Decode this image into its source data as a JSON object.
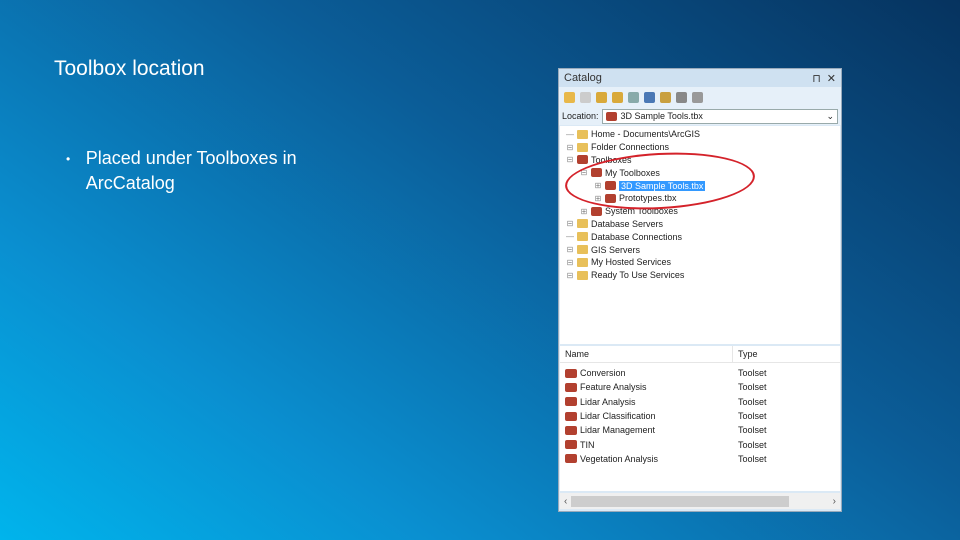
{
  "slide": {
    "title": "Toolbox location",
    "bullet": "Placed under Toolboxes in ArcCatalog",
    "bullet_marker": "•"
  },
  "catalog": {
    "title": "Catalog",
    "pin": "⊓",
    "close": "✕",
    "location_label": "Location:",
    "location_value": "3D Sample Tools.tbx",
    "tree": [
      {
        "label": "Home - Documents\\ArcGIS",
        "indent": 0,
        "icon": "folder",
        "exp": "—"
      },
      {
        "label": "Folder Connections",
        "indent": 0,
        "icon": "folder",
        "exp": "⊟"
      },
      {
        "label": "Toolboxes",
        "indent": 0,
        "icon": "toolbox",
        "exp": "⊟"
      },
      {
        "label": "My Toolboxes",
        "indent": 1,
        "icon": "toolbox",
        "exp": "⊟"
      },
      {
        "label": "3D Sample Tools.tbx",
        "indent": 2,
        "icon": "toolbox",
        "exp": "⊞",
        "selected": true
      },
      {
        "label": "Prototypes.tbx",
        "indent": 2,
        "icon": "toolbox",
        "exp": "⊞"
      },
      {
        "label": "System Toolboxes",
        "indent": 1,
        "icon": "toolbox",
        "exp": "⊞"
      },
      {
        "label": "Database Servers",
        "indent": 0,
        "icon": "folder",
        "exp": "⊟"
      },
      {
        "label": "Database Connections",
        "indent": 0,
        "icon": "folder",
        "exp": "—"
      },
      {
        "label": "GIS Servers",
        "indent": 0,
        "icon": "folder",
        "exp": "⊟"
      },
      {
        "label": "My Hosted Services",
        "indent": 0,
        "icon": "folder",
        "exp": "⊟"
      },
      {
        "label": "Ready To Use Services",
        "indent": 0,
        "icon": "folder",
        "exp": "⊟"
      }
    ],
    "list_headers": {
      "name": "Name",
      "type": "Type"
    },
    "rows": [
      {
        "name": "Conversion",
        "type": "Toolset"
      },
      {
        "name": "Feature Analysis",
        "type": "Toolset"
      },
      {
        "name": "Lidar Analysis",
        "type": "Toolset"
      },
      {
        "name": "Lidar Classification",
        "type": "Toolset"
      },
      {
        "name": "Lidar Management",
        "type": "Toolset"
      },
      {
        "name": "TIN",
        "type": "Toolset"
      },
      {
        "name": "Vegetation Analysis",
        "type": "Toolset"
      }
    ],
    "scroll_left": "‹",
    "scroll_right": "›"
  },
  "colors": {
    "highlight": "#d4222a",
    "selection": "#3399ff"
  }
}
